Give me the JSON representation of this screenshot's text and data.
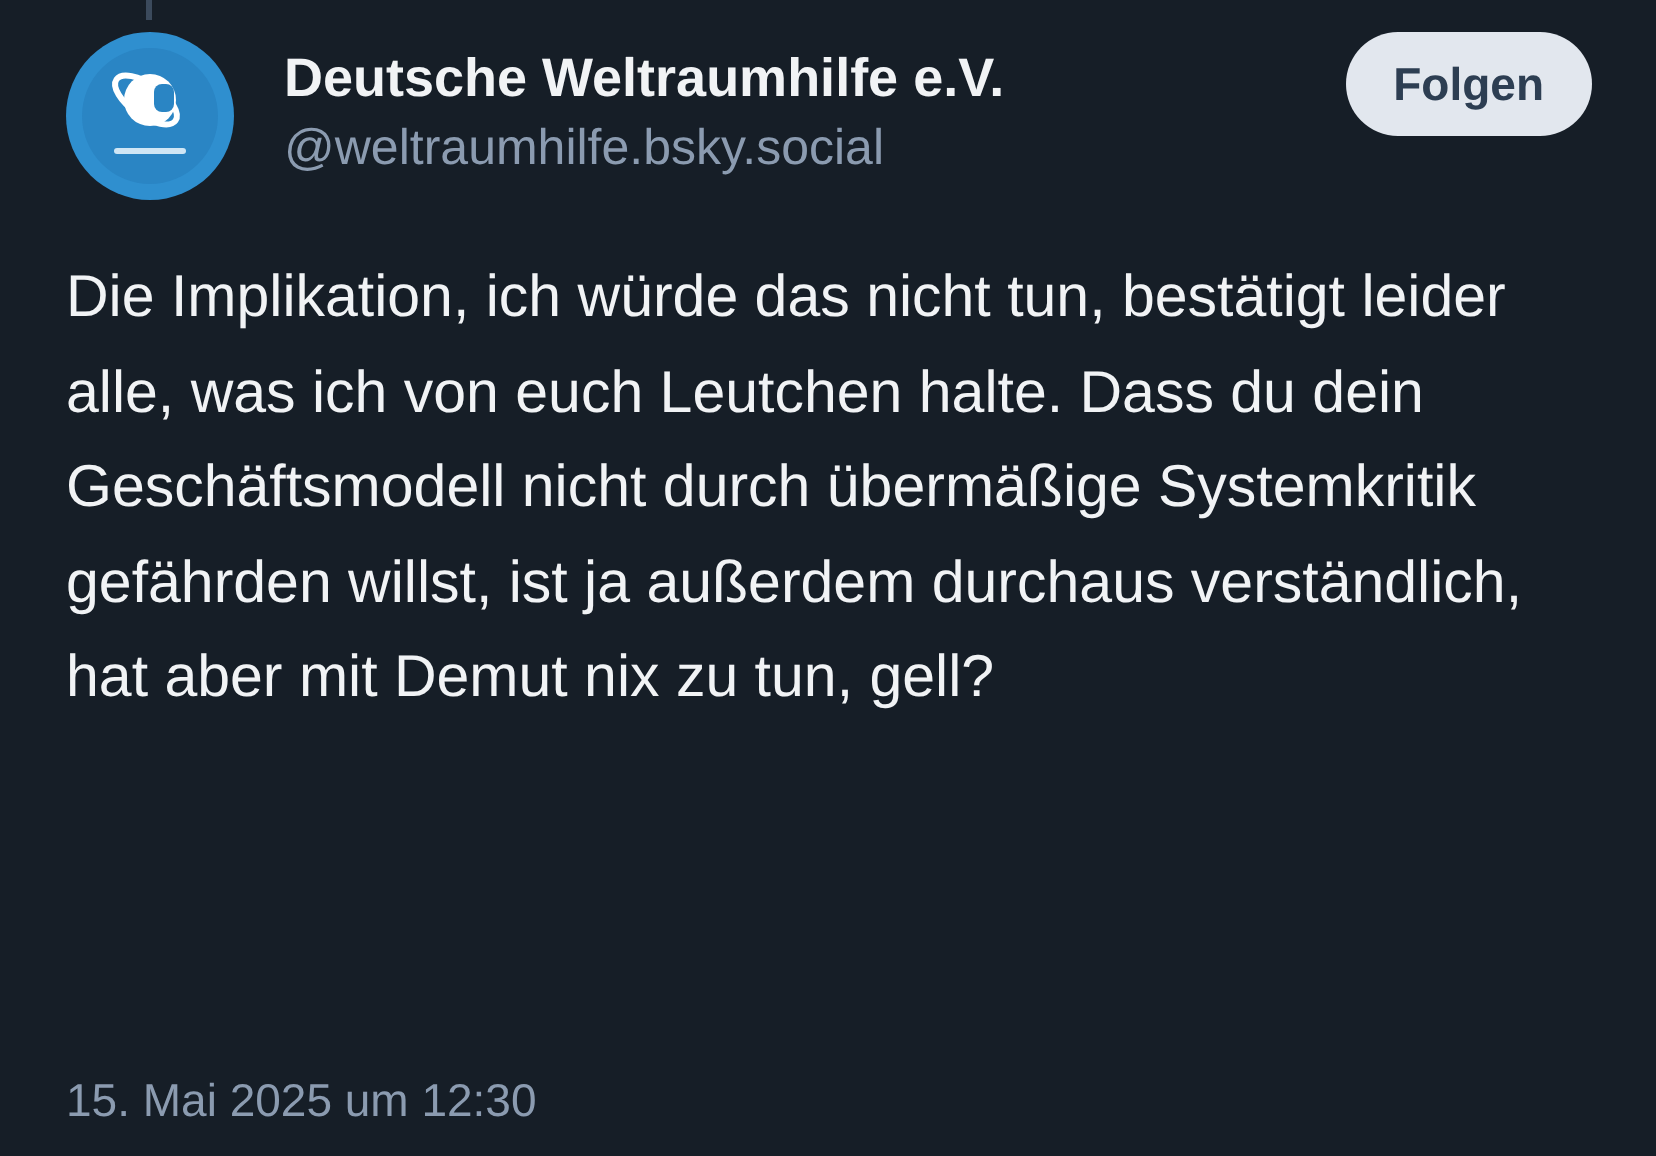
{
  "post": {
    "author": {
      "name": "Deutsche Weltraumhilfe e.V.",
      "handle": "@weltraumhilfe.bsky.social"
    },
    "follow_button": "Folgen",
    "text": "Die Implikation, ich würde das nicht tun, bestätigt leider alle, was ich von euch Leutchen halte. Dass du dein Geschäftsmodell nicht durch übermäßige Systemkritik gefährden willst, ist ja außerdem durchaus verständlich, hat aber mit Demut nix zu tun, gell?",
    "timestamp": "15. Mai 2025 um 12:30"
  }
}
